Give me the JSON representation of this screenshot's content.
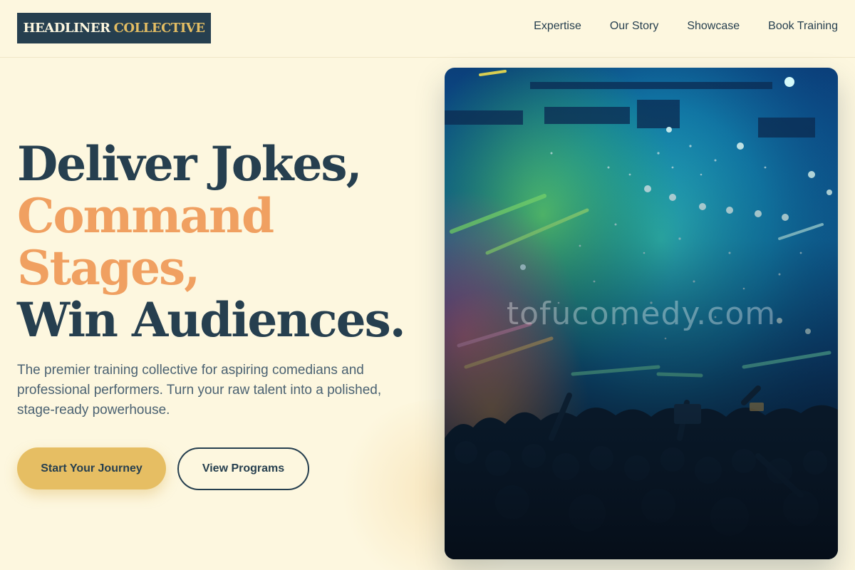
{
  "header": {
    "logo_primary": "HEADLINER",
    "logo_accent": "COLLECTIVE",
    "nav": [
      {
        "label": "Expertise"
      },
      {
        "label": "Our Story"
      },
      {
        "label": "Showcase"
      },
      {
        "label": "Book Training"
      }
    ]
  },
  "hero": {
    "headline": {
      "line1": "Deliver Jokes,",
      "line2": "Command",
      "line3": "Stages,",
      "line4": "Win Audiences."
    },
    "subtitle": "The premier training collective for aspiring comedians and professional performers. Turn your raw talent into a polished, stage-ready powerhouse.",
    "primary_button": "Start Your Journey",
    "secondary_button": "View Programs",
    "image": {
      "description": "concert-crowd-with-stage-lights",
      "watermark": "tofucomedy.com"
    }
  },
  "colors": {
    "background": "#fdf7df",
    "navy": "#263f4f",
    "accent_orange": "#f0a061",
    "gold": "#e6be63"
  }
}
